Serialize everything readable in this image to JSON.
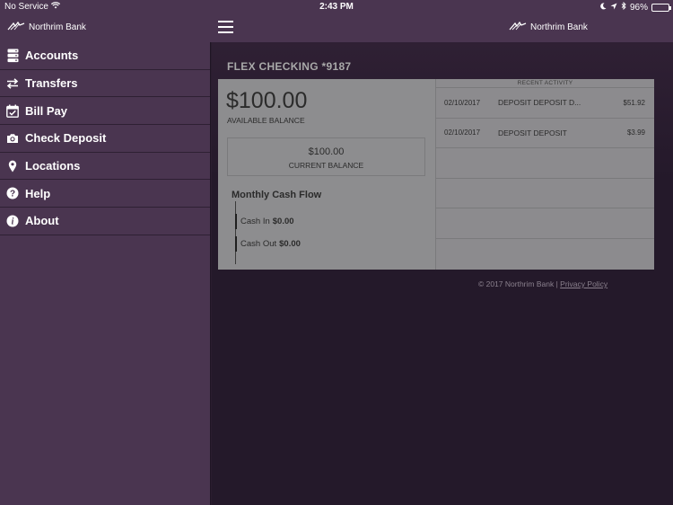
{
  "status": {
    "carrier": "No Service",
    "time": "2:43 PM",
    "battery": "96%",
    "battery_level": 0.96
  },
  "header": {
    "brand_left": "Northrim Bank",
    "brand_right": "Northrim Bank"
  },
  "sidebar": {
    "items": [
      {
        "label": "Accounts",
        "icon": "database-icon"
      },
      {
        "label": "Transfers",
        "icon": "transfer-arrows-icon"
      },
      {
        "label": "Bill Pay",
        "icon": "calendar-check-icon"
      },
      {
        "label": "Check Deposit",
        "icon": "camera-icon"
      },
      {
        "label": "Locations",
        "icon": "map-pin-icon"
      },
      {
        "label": "Help",
        "icon": "question-circle-icon"
      },
      {
        "label": "About",
        "icon": "info-circle-icon"
      }
    ]
  },
  "account": {
    "title": "FLEX CHECKING *9187",
    "available_balance": "$100.00",
    "available_label": "AVAILABLE BALANCE",
    "current_balance": "$100.00",
    "current_label": "CURRENT BALANCE",
    "cash_flow": {
      "title": "Monthly Cash Flow",
      "cash_in_label": "Cash In",
      "cash_in": "$0.00",
      "cash_out_label": "Cash Out",
      "cash_out": "$0.00"
    }
  },
  "recent_activity": {
    "title": "RECENT ACTIVITY",
    "rows": [
      {
        "date": "02/10/2017",
        "description": "DEPOSIT DEPOSIT D...",
        "amount": "$51.92"
      },
      {
        "date": "02/10/2017",
        "description": "DEPOSIT DEPOSIT",
        "amount": "$3.99"
      }
    ]
  },
  "footer": {
    "copyright": "© 2017 Northrim Bank |",
    "privacy": "Privacy Policy"
  }
}
